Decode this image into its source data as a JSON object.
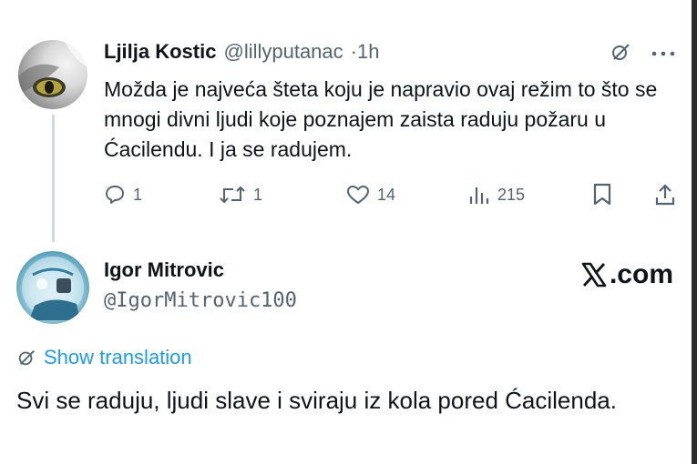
{
  "reply_to_tweet": {
    "author_name": "Ljilja Kostic",
    "author_handle": "@lillyputanac",
    "separator": "·",
    "time": "1h",
    "text": "Možda je najveća šteta koju je napravio ovaj režim to što se mnogi divni ljudi koje poznajem zaista raduju požaru u Ćacilendu. I ja se radujem.",
    "replies": "1",
    "reposts": "1",
    "likes": "14",
    "views": "215",
    "icons": [
      "grok-icon",
      "more-icon",
      "reply-icon",
      "repost-icon",
      "like-icon",
      "views-icon",
      "bookmark-icon",
      "share-icon"
    ]
  },
  "tweet": {
    "author_name": "Igor Mitrovic",
    "author_handle": "@IgorMitrovic100",
    "watermark": ".com",
    "translate_label": "Show translation",
    "text": "Svi se raduju, ljudi slave i sviraju iz kola pored Ćacilenda."
  },
  "colors": {
    "text": "#0f1419",
    "secondary": "#536471",
    "link": "#1d9bf0",
    "thread_line": "#cfd9de"
  }
}
